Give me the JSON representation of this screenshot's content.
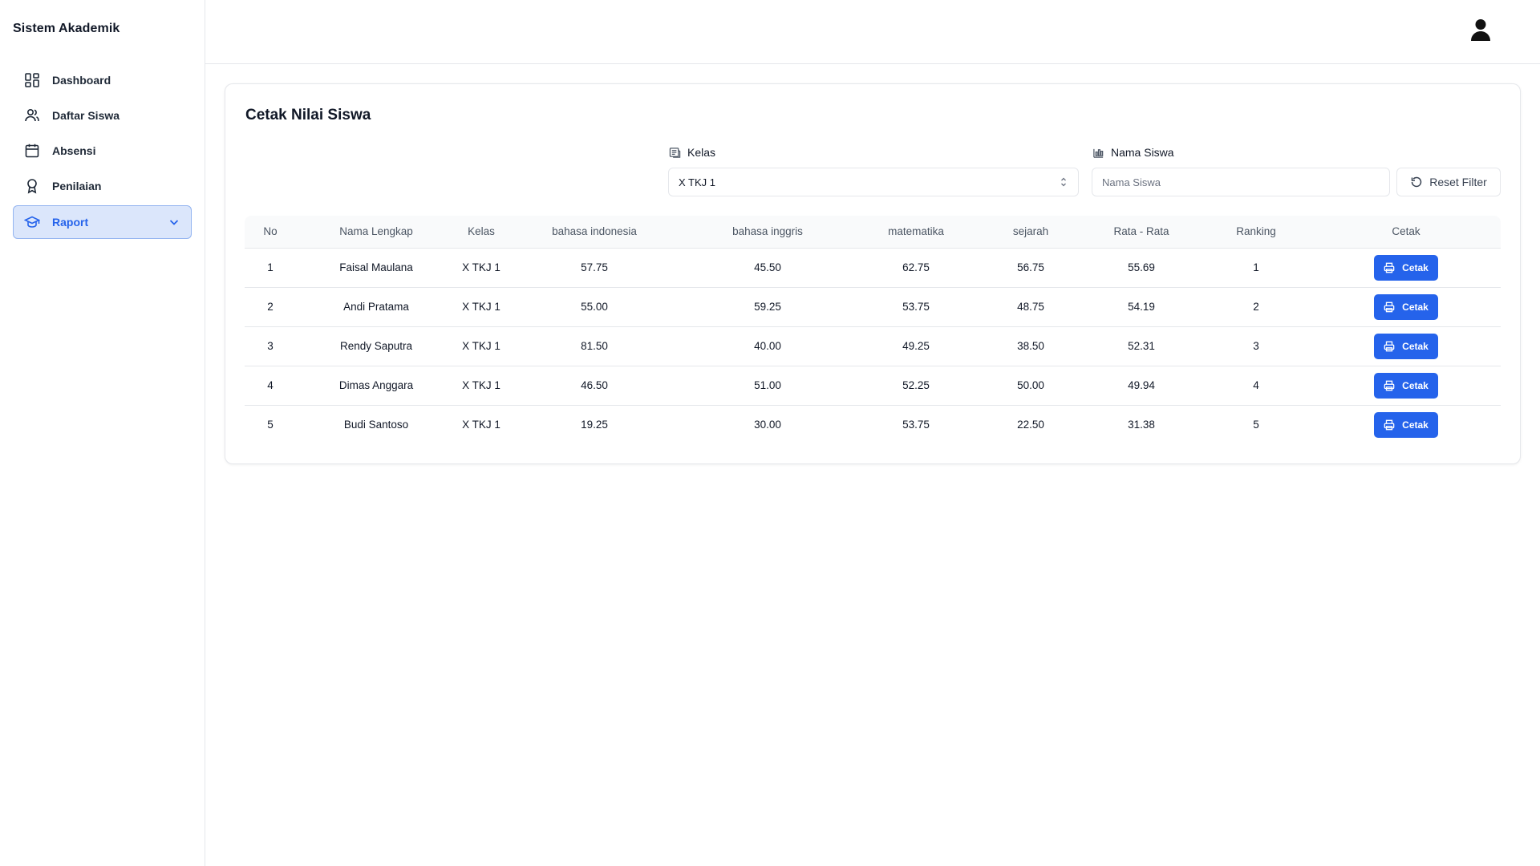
{
  "app": {
    "title": "Sistem Akademik"
  },
  "sidebar": {
    "items": [
      {
        "label": "Dashboard",
        "icon": "dashboard-grid-icon"
      },
      {
        "label": "Daftar Siswa",
        "icon": "users-icon"
      },
      {
        "label": "Absensi",
        "icon": "calendar-icon"
      },
      {
        "label": "Penilaian",
        "icon": "award-icon"
      },
      {
        "label": "Raport",
        "icon": "graduation-cap-icon",
        "active": true
      }
    ]
  },
  "page": {
    "title": "Cetak Nilai Siswa",
    "filters": {
      "kelas_label": "Kelas",
      "kelas_value": "X TKJ 1",
      "nama_label": "Nama Siswa",
      "nama_placeholder": "Nama Siswa",
      "nama_value": "",
      "reset_label": "Reset Filter"
    },
    "table": {
      "headers": [
        "No",
        "Nama Lengkap",
        "Kelas",
        "bahasa indonesia",
        "bahasa inggris",
        "matematika",
        "sejarah",
        "Rata - Rata",
        "Ranking",
        "Cetak"
      ],
      "button_label": "Cetak",
      "rows": [
        [
          "1",
          "Faisal Maulana",
          "X TKJ 1",
          "57.75",
          "45.50",
          "62.75",
          "56.75",
          "55.69",
          "1"
        ],
        [
          "2",
          "Andi Pratama",
          "X TKJ 1",
          "55.00",
          "59.25",
          "53.75",
          "48.75",
          "54.19",
          "2"
        ],
        [
          "3",
          "Rendy Saputra",
          "X TKJ 1",
          "81.50",
          "40.00",
          "49.25",
          "38.50",
          "52.31",
          "3"
        ],
        [
          "4",
          "Dimas Anggara",
          "X TKJ 1",
          "46.50",
          "51.00",
          "52.25",
          "50.00",
          "49.94",
          "4"
        ],
        [
          "5",
          "Budi Santoso",
          "X TKJ 1",
          "19.25",
          "30.00",
          "53.75",
          "22.50",
          "31.38",
          "5"
        ]
      ]
    }
  },
  "colors": {
    "accent": "#2563eb",
    "active_bg": "#dbe6fb",
    "border": "#e5e7eb"
  }
}
